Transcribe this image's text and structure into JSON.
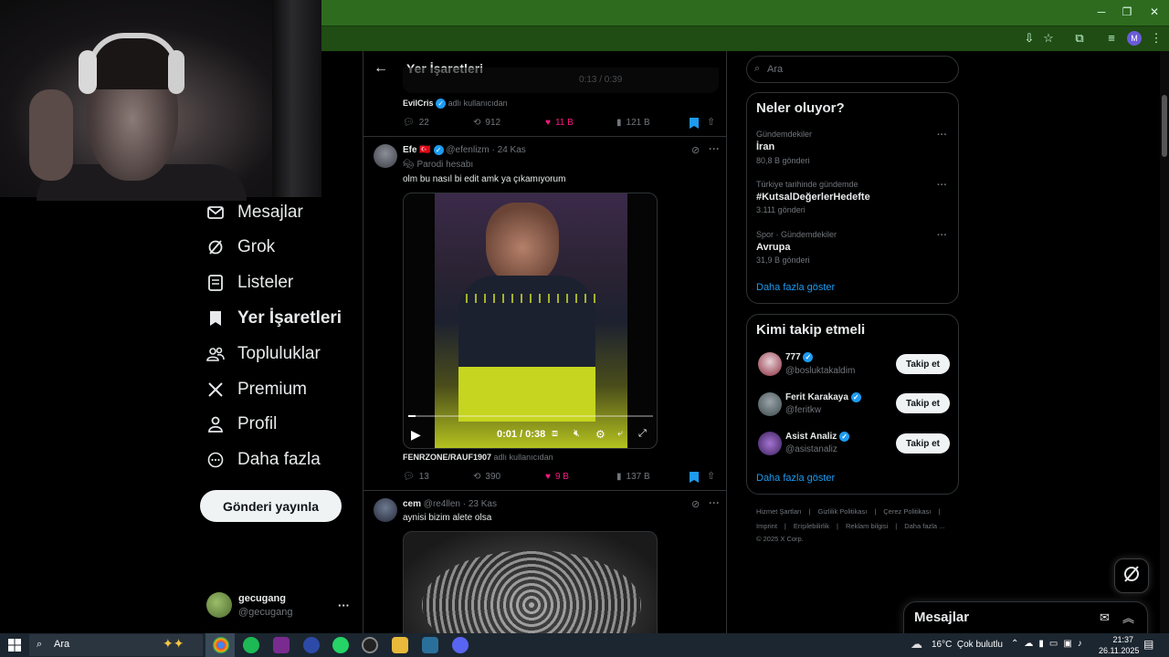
{
  "chrome": {
    "window_controls": [
      "─",
      "❐",
      "✕"
    ]
  },
  "left_nav": {
    "items": [
      {
        "label": "Mesajlar",
        "icon": "mail-icon"
      },
      {
        "label": "Grok",
        "icon": "grok-icon"
      },
      {
        "label": "Listeler",
        "icon": "list-icon"
      },
      {
        "label": "Yer İşaretleri",
        "icon": "bookmark-icon",
        "active": true
      },
      {
        "label": "Topluluklar",
        "icon": "communities-icon"
      },
      {
        "label": "Premium",
        "icon": "x-logo-icon"
      },
      {
        "label": "Profil",
        "icon": "profile-icon"
      },
      {
        "label": "Daha fazla",
        "icon": "more-circle-icon"
      }
    ],
    "post_button": "Gönderi yayınla",
    "user": {
      "name": "gecugang",
      "handle": "@gecugang",
      "more": "···"
    }
  },
  "center": {
    "header_title": "Yer İşaretleri",
    "prev_tweet": {
      "video_time": "0:13 / 0:39",
      "credit_name": "EvilCris",
      "credit_suffix": "adlı kullanıcıdan",
      "replies": "22",
      "retweets": "912",
      "likes": "11 B",
      "views": "121 B"
    },
    "tweet1": {
      "name": "Efe",
      "flag": "🇹🇷",
      "handle": "@efenlizm",
      "date": "· 24 Kas",
      "parody": "Parodi hesabı",
      "text": "olm bu nasıl bi edit amk ya çıkamıyorum",
      "video_time": "0:01 / 0:38",
      "video_progress": 0.03,
      "credit_name": "FENRZONE/RAUF1907",
      "credit_suffix": "adlı kullanıcıdan",
      "replies": "13",
      "retweets": "390",
      "likes": "9 B",
      "views": "137 B"
    },
    "tweet2": {
      "name": "cem",
      "handle": "@re4llen",
      "date": "· 23 Kas",
      "text": "aynisi bizim alete olsa"
    }
  },
  "right": {
    "search_placeholder": "Ara",
    "trends": {
      "title": "Neler oluyor?",
      "items": [
        {
          "context": "Gündemdekiler",
          "name": "İran",
          "count": "80,8 B gönderi"
        },
        {
          "context": "Türkiye tarihinde gündemde",
          "name": "#KutsalDeğerlerHedefte",
          "count": "3.111 gönderi"
        },
        {
          "context": "Spor · Gündemdekiler",
          "name": "Avrupa",
          "count": "31,9 B gönderi"
        }
      ],
      "more": "Daha fazla göster"
    },
    "who_to_follow": {
      "title": "Kimi takip etmeli",
      "items": [
        {
          "name": "777",
          "handle": "@bosluktakaldim",
          "button": "Takip et"
        },
        {
          "name": "Ferit Karakaya",
          "handle": "@feritkw",
          "button": "Takip et"
        },
        {
          "name": "Asist Analiz",
          "handle": "@asistanaliz",
          "button": "Takip et"
        }
      ],
      "more": "Daha fazla göster"
    },
    "footer": {
      "row1": [
        "Hizmet Şartları",
        "|",
        "Gizlilik Politikası",
        "|",
        "Çerez Politikası",
        "|"
      ],
      "row2": [
        "Imprint",
        "|",
        "Erişilebilirlik",
        "|",
        "Reklam bilgisi",
        "|",
        "Daha fazla ..."
      ],
      "copyright": "© 2025 X Corp."
    },
    "messages_dock": "Mesajlar"
  },
  "taskbar": {
    "search": "Ara",
    "weather": "16°C  Çok bulutlu",
    "time": "21:37",
    "date": "26.11.2025"
  },
  "colors": {
    "accent": "#1d9bf0",
    "like": "#f91880",
    "chrome_green": "#2e6b1f"
  }
}
